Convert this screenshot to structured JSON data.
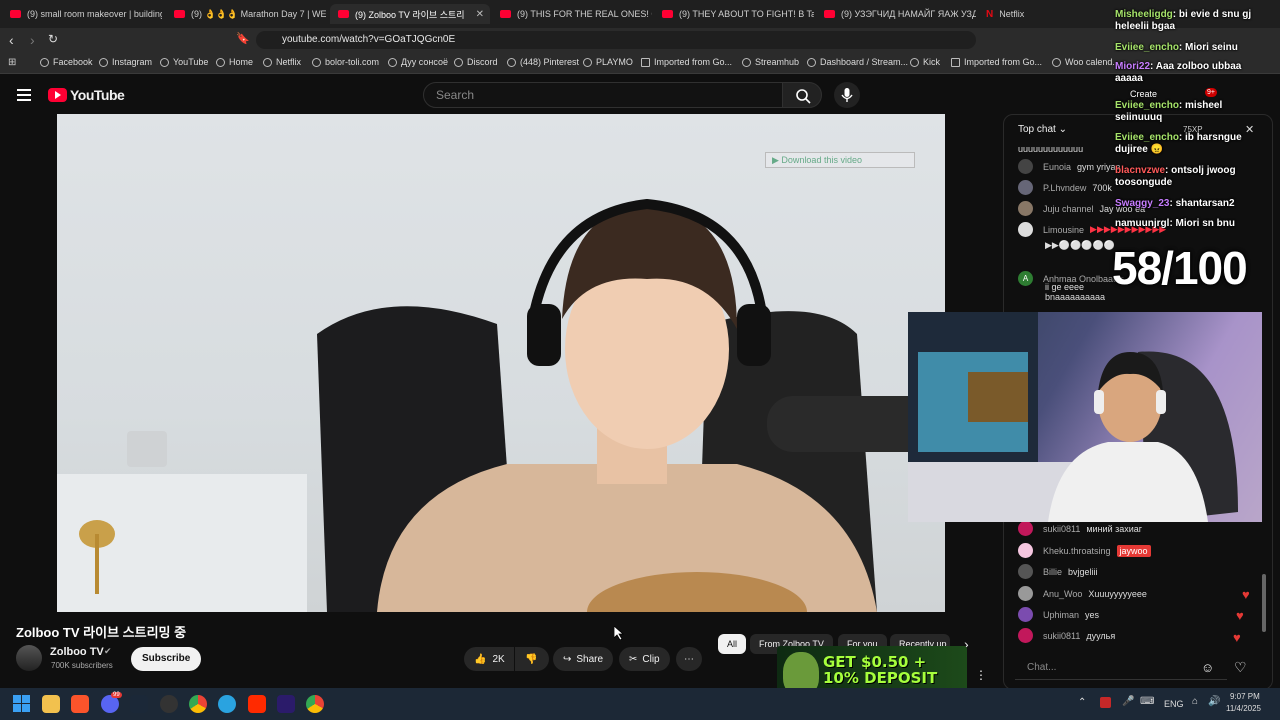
{
  "tabs": [
    {
      "label": "(9) small room makeover | building n",
      "active": false
    },
    {
      "label": "(9) 👌👌👌 Marathon Day 7 | WE U",
      "active": false
    },
    {
      "label": "(9) Zolboo TV 라이브 스트리",
      "active": true
    },
    {
      "label": "(9) THIS FOR THE REAL ONES! Ginjin",
      "active": false
    },
    {
      "label": "(9) THEY ABOUT TO FIGHT! B Tamir",
      "active": false
    },
    {
      "label": "(9) УЗЭГЧИД НАМАЙГ ЯАЖ УЗДЭГ",
      "active": false
    },
    {
      "label": "Netflix",
      "active": false
    }
  ],
  "address": {
    "url": "youtube.com/watch?v=GOaTJQGcn0E"
  },
  "bookmarks": [
    "Facebook",
    "Instagram",
    "YouTube",
    "Home",
    "Netflix",
    "bolor-toli.com",
    "Дуу сонсоё",
    "Discord",
    "(448) Pinterest",
    "PLAYMO",
    "Imported from Go...",
    "Streamhub",
    "Dashboard / Stream...",
    "Kick",
    "Imported from Go...",
    "Woo calend..."
  ],
  "youtube": {
    "logo_text": "YouTube",
    "search_placeholder": "Search",
    "create_label": "Create",
    "notif_count": "9+",
    "video_title": "Zolboo TV 라이브 스트리밍 중",
    "channel_name": "Zolboo TV",
    "subscribers": "700K subscribers",
    "subscribe_label": "Subscribe",
    "like_count": "2K",
    "share_label": "Share",
    "clip_label": "Clip",
    "download_label": "Download this video",
    "chips": [
      "All",
      "From Zolboo TV",
      "For you",
      "Recently up"
    ]
  },
  "chat": {
    "header": "Top chat",
    "placeholder": "Chat...",
    "xp": "75XP",
    "messages": [
      {
        "name": "",
        "text": "uuuuuuuuuuuuu"
      },
      {
        "name": "Eunoia",
        "text": "gym yriyaa"
      },
      {
        "name": "P.Lhvndew",
        "text": "700k"
      },
      {
        "name": "Juju channel",
        "text": "Jay woo ea"
      },
      {
        "name": "Limousine",
        "text": "▶▶▶▶▶▶▶▶▶▶▶"
      },
      {
        "name": "",
        "text": "▶▶⚪⚪⚪⚪⚪⚪⚪⚪⚪⚪ hjjejennnnnnnennnnnnn"
      },
      {
        "name": "Anhmaa Onolbaatar",
        "text": "ii ge eeee bnaaaaaaaaaa saaaaaaaaaeeeeeeee zolboooooooo ahaaaaaaaaaaaa"
      },
      {
        "name": "sukii0811",
        "text": "миний захиаг"
      },
      {
        "name": "Kheku.throatsing",
        "text": "jaywoo"
      },
      {
        "name": "Billie",
        "text": "bvjgeliii"
      },
      {
        "name": "Anu_Woo",
        "text": "Xuuuyyyyyeee"
      },
      {
        "name": "Uphiman",
        "text": "yes"
      },
      {
        "name": "sukii0811",
        "text": "дуулья"
      }
    ]
  },
  "overlay": {
    "counter": "58/100",
    "messages": [
      {
        "user": "Misheeligdg",
        "text": ": bi evie d snu gj heleelii bgaa"
      },
      {
        "user": "Eviiee_encho",
        "text": ": Miori seinu"
      },
      {
        "user": "Miori22",
        "text": ": Aaa zolboo ubbaa aaaaa"
      },
      {
        "user": "Eviiee_encho",
        "text": ": misheel seiinuuuq"
      },
      {
        "user": "Eviiee_encho",
        "text": ": ib harsngue dujiree 😠"
      },
      {
        "user": "blacnvzwe",
        "text": ": ontsolj jwoog toosongude"
      },
      {
        "user": "Swaggy_23",
        "text": ": shantarsan2"
      },
      {
        "user": "namuunjrgl",
        "text": ": Miori sn bnu"
      }
    ]
  },
  "ad": {
    "text": "GET $0.50 + 10% DEPOSIT BONUS"
  },
  "taskbar": {
    "lang": "ENG",
    "time": "9:07 PM",
    "date": "11/4/2025",
    "discord_badge": "99"
  },
  "colors": {
    "yt_red": "#ff0033",
    "bg": "#0f0f0f",
    "taskbar": "#1c2836"
  }
}
